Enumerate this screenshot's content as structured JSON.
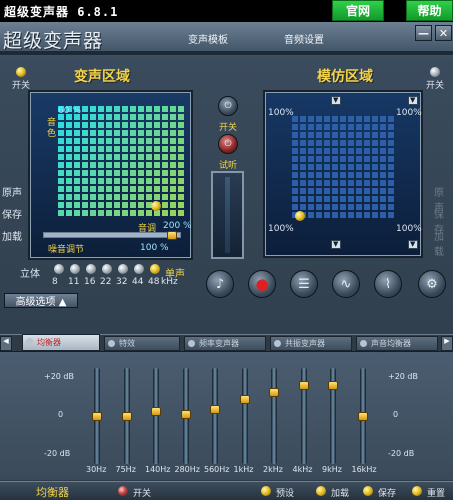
{
  "window": {
    "title": "超级变声器 6.8.1",
    "official_site": "官网",
    "help": "帮助"
  },
  "header": {
    "brand": "超级变声器",
    "menu": [
      "变声模板",
      "音频设置"
    ],
    "minimize": "—",
    "close": "✕"
  },
  "voice_zone": {
    "title": "变声区域",
    "power_label": "开关",
    "percent_top": "60 %",
    "color_label": "音色",
    "pitch_label": "音调",
    "pitch_value": "200 %",
    "noise_label": "噪音调节",
    "noise_value": "100 %",
    "pitch_level": 1.0,
    "noise_level": 1.0
  },
  "imitate_zone": {
    "title": "模仿区域",
    "power_label": "开关",
    "tl": "100%",
    "tr": "100%",
    "bl": "100%",
    "br": "100%"
  },
  "center": {
    "power_label": "开关",
    "listen_label": "试听"
  },
  "left_labels": [
    "原声",
    "保存",
    "加载"
  ],
  "right_labels": [
    "原声",
    "保存",
    "加载"
  ],
  "stereo": {
    "label": "立体",
    "mono_label": "单声",
    "rates": [
      "8",
      "11",
      "16",
      "22",
      "32",
      "44",
      "48"
    ],
    "unit": "kHz",
    "selected": "48"
  },
  "advanced": {
    "label": "高级选项 ▲"
  },
  "tools": [
    "note-icon",
    "record-icon",
    "mixer-icon",
    "wave-icon",
    "pulse-icon",
    "settings-icon"
  ],
  "tabs": [
    {
      "label": "均衡器",
      "active": true
    },
    {
      "label": "特效",
      "active": false
    },
    {
      "label": "频率变声器",
      "active": false
    },
    {
      "label": "共振变声器",
      "active": false
    },
    {
      "label": "声音均衡器",
      "active": false
    }
  ],
  "eq": {
    "left_top": "+20 dB",
    "left_mid": "0",
    "left_bottom": "-20 dB",
    "right_top": "+20 dB",
    "right_mid": "0",
    "right_bottom": "-20 dB",
    "bands": [
      {
        "label": "30Hz",
        "level": 0
      },
      {
        "label": "75Hz",
        "level": 0
      },
      {
        "label": "140Hz",
        "level": 2
      },
      {
        "label": "280Hz",
        "level": 1
      },
      {
        "label": "560Hz",
        "level": 3
      },
      {
        "label": "1kHz",
        "level": 7
      },
      {
        "label": "2kHz",
        "level": 10
      },
      {
        "label": "4kHz",
        "level": 13
      },
      {
        "label": "9kHz",
        "level": 13
      },
      {
        "label": "16kHz",
        "level": 0
      }
    ]
  },
  "bottom": {
    "title": "均衡器",
    "power_label": "开关",
    "preset_label": "预设",
    "load_label": "加载",
    "save_label": "保存",
    "reset_label": "重置"
  },
  "colors": {
    "accent_yellow": "#f3d54a",
    "green_button": "#1fb83a",
    "panel": "#31414f"
  }
}
